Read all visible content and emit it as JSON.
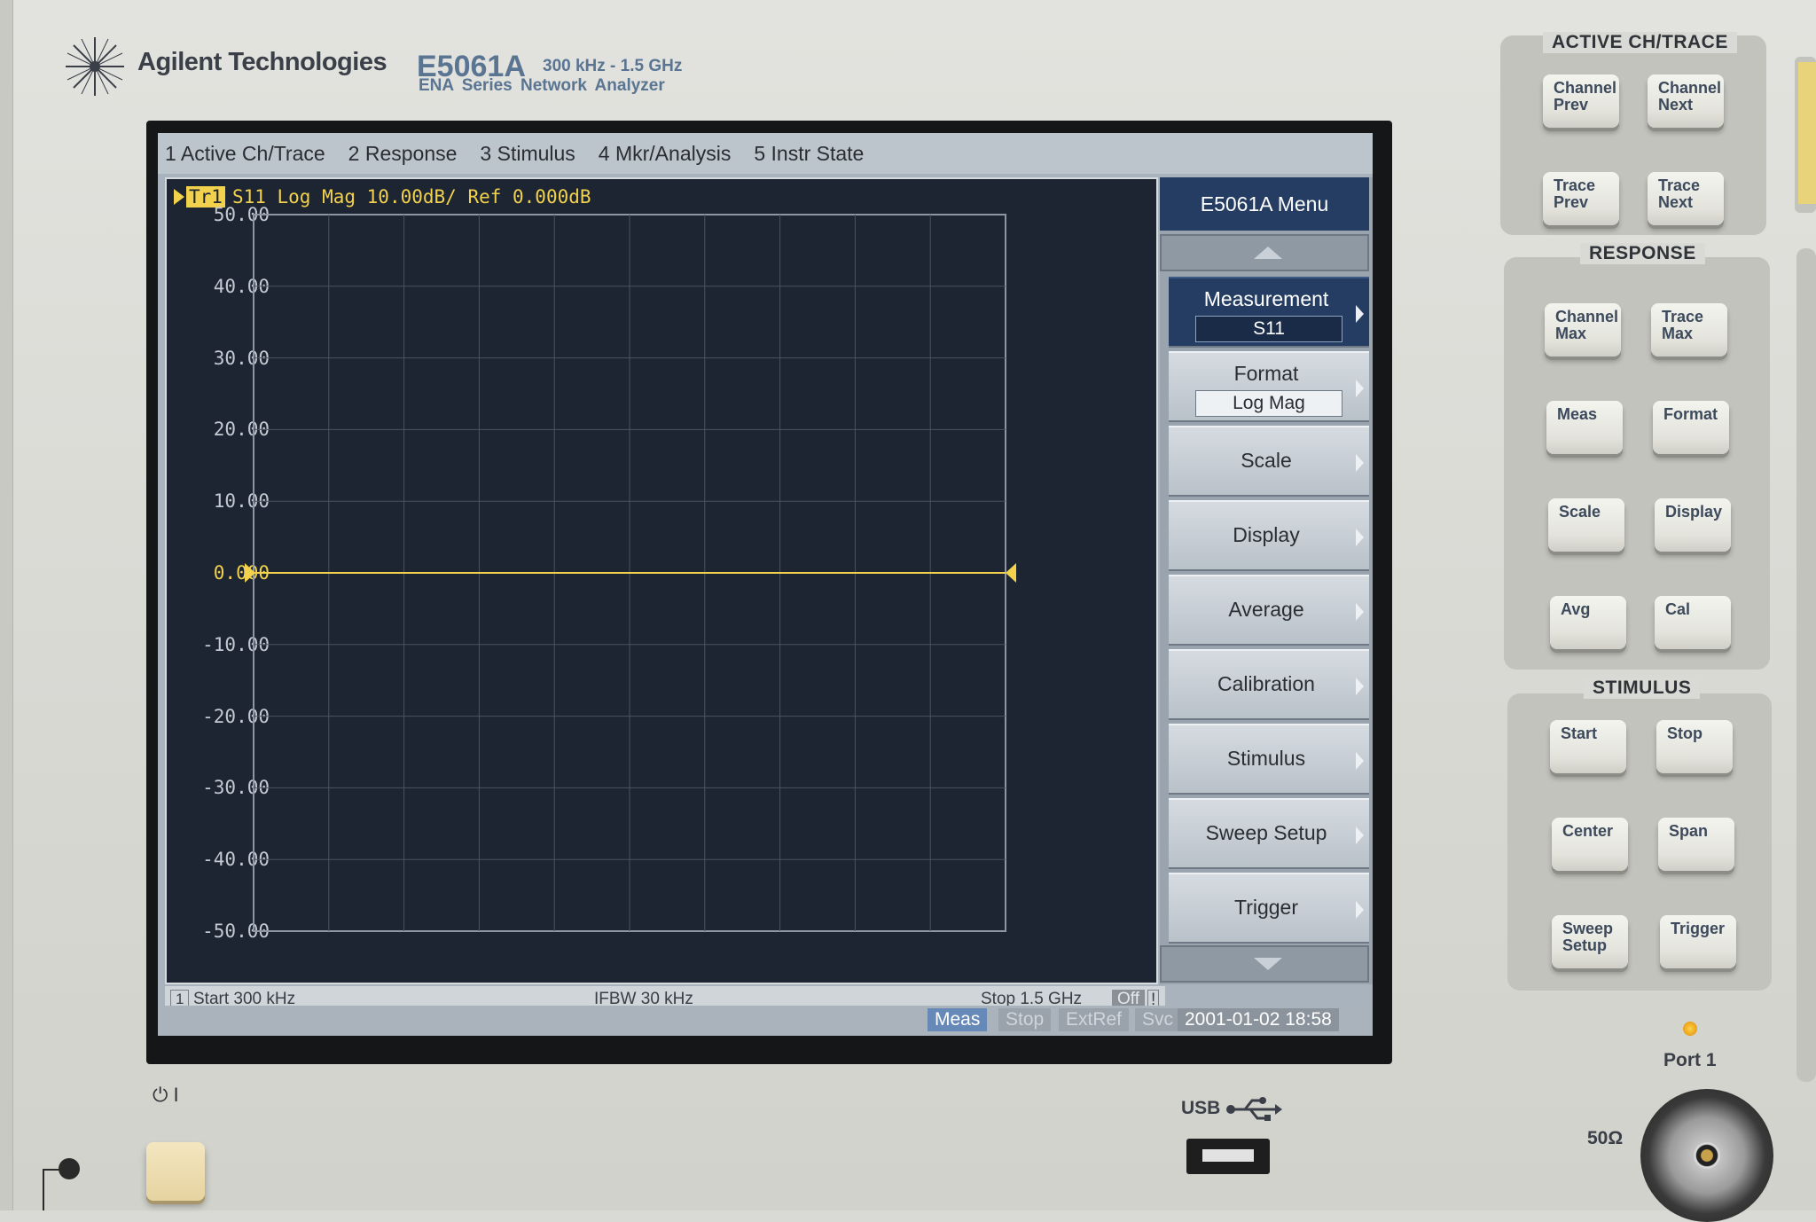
{
  "brand": {
    "name": "Agilent Technologies",
    "model": "E5061A",
    "freq_range": "300 kHz - 1.5 GHz",
    "series": "ENA  Series  Network  Analyzer"
  },
  "menubar": [
    "1 Active Ch/Trace",
    "2 Response",
    "3 Stimulus",
    "4 Mkr/Analysis",
    "5 Instr State"
  ],
  "trace": {
    "tag": "Tr1",
    "title": "S11  Log Mag  10.00dB/  Ref  0.000dB",
    "y_ticks": [
      "50.00",
      "40.00",
      "30.00",
      "20.00",
      "10.00",
      "0.000",
      "-10.00",
      "-20.00",
      "-30.00",
      "-40.00",
      "-50.00"
    ]
  },
  "chart_data": {
    "type": "line",
    "xlabel": "",
    "ylabel": "",
    "ylim": [
      -50,
      50
    ],
    "x": [
      "Start 300 kHz",
      "Stop 1.5 GHz"
    ],
    "series": [
      {
        "values": [
          0.0,
          0.0
        ]
      }
    ],
    "grid": true
  },
  "status": {
    "channel": "1",
    "start": "Start 300 kHz",
    "ifbw": "IFBW 30 kHz",
    "stop": "Stop 1.5 GHz",
    "off": "Off",
    "bang": "!"
  },
  "bottombar": {
    "meas": "Meas",
    "stop": "Stop",
    "extref": "ExtRef",
    "svc": "Svc",
    "datetime": "2001-01-02 18:58"
  },
  "softkeys": {
    "title": "E5061A Menu",
    "items": [
      {
        "label": "Measurement",
        "value": "S11"
      },
      {
        "label": "Format",
        "value": "Log Mag"
      },
      {
        "label": "Scale"
      },
      {
        "label": "Display"
      },
      {
        "label": "Average"
      },
      {
        "label": "Calibration"
      },
      {
        "label": "Stimulus"
      },
      {
        "label": "Sweep Setup"
      },
      {
        "label": "Trigger"
      }
    ]
  },
  "hw": {
    "active_title": "ACTIVE CH/TRACE",
    "response_title": "RESPONSE",
    "stimulus_title": "STIMULUS",
    "active": [
      {
        "l1": "Channel",
        "l2": "Prev"
      },
      {
        "l1": "Channel",
        "l2": "Next"
      },
      {
        "l1": "Trace",
        "l2": "Prev"
      },
      {
        "l1": "Trace",
        "l2": "Next"
      }
    ],
    "response": [
      {
        "l1": "Channel",
        "l2": "Max"
      },
      {
        "l1": "Trace",
        "l2": "Max"
      },
      {
        "l1": "Meas",
        "l2": ""
      },
      {
        "l1": "Format",
        "l2": ""
      },
      {
        "l1": "Scale",
        "l2": ""
      },
      {
        "l1": "Display",
        "l2": ""
      },
      {
        "l1": "Avg",
        "l2": ""
      },
      {
        "l1": "Cal",
        "l2": ""
      }
    ],
    "stimulus": [
      {
        "l1": "Start",
        "l2": ""
      },
      {
        "l1": "Stop",
        "l2": ""
      },
      {
        "l1": "Center",
        "l2": ""
      },
      {
        "l1": "Span",
        "l2": ""
      },
      {
        "l1": "Sweep",
        "l2": "Setup"
      },
      {
        "l1": "Trigger",
        "l2": ""
      }
    ]
  },
  "port": {
    "label": "Port 1",
    "impedance": "50Ω"
  },
  "usb": {
    "label": "USB"
  },
  "power": {
    "symbols": "⏻ I"
  },
  "colors": {
    "trace": "#f2d24c",
    "graph_bg": "#1d2432",
    "softkey_active": "#253d63"
  }
}
